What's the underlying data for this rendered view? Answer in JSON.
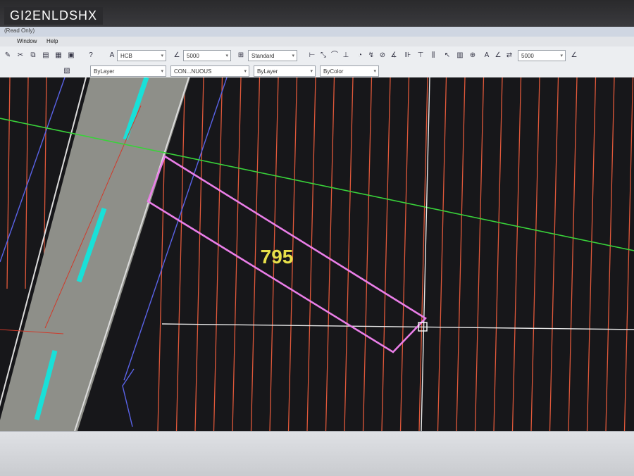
{
  "watermark": "GI2ENLDSHX",
  "window": {
    "title": "(Read Only)"
  },
  "menu": {
    "items": [
      "Window",
      "Help"
    ]
  },
  "toolbar": {
    "text_style": "HCB",
    "dim_value": "5000",
    "dim_style": "Standard",
    "dim_value_right": "5000"
  },
  "layer_bar": {
    "color": "ByLayer",
    "linetype": "CON...NUOUS",
    "lineweight": "ByLayer",
    "plotstyle": "ByColor"
  },
  "drawing": {
    "parcel_label": "795",
    "colors": {
      "background": "#17171a",
      "hatch": "#e0583a",
      "road_fill": "#8e8f89",
      "road_dash": "#19e0d8",
      "parcel_outline": "#ea7ee8",
      "label": "#e8e04a",
      "green_line": "#39d23a",
      "blue_line": "#5a63e8",
      "crosshair": "#e8e8e8"
    },
    "icons": [
      "crosshair-pickbox-icon"
    ]
  }
}
